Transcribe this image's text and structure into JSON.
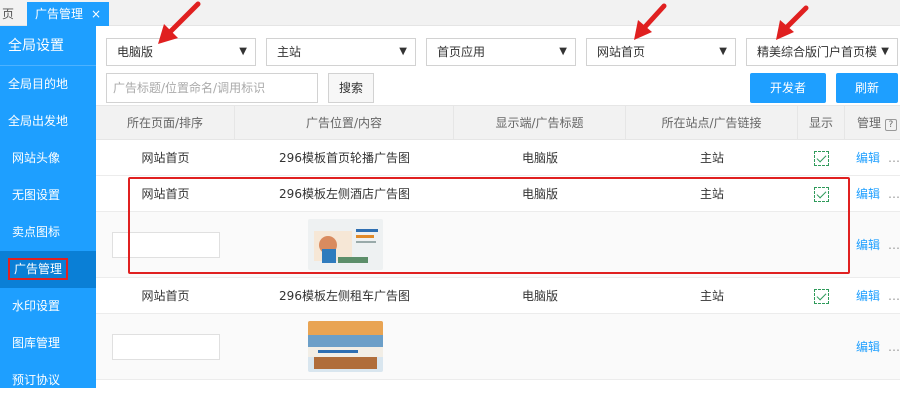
{
  "tabs": {
    "home_label": "页",
    "active_label": "广告管理",
    "close_glyph": "×"
  },
  "sidebar": {
    "title": "全局设置",
    "items": [
      {
        "label": "全局目的地"
      },
      {
        "label": "全局出发地"
      },
      {
        "label": "网站头像"
      },
      {
        "label": "无图设置"
      },
      {
        "label": "卖点图标"
      },
      {
        "label": "广告管理"
      },
      {
        "label": "水印设置"
      },
      {
        "label": "图库管理"
      },
      {
        "label": "预订协议"
      }
    ]
  },
  "filters": {
    "device": "电脑版",
    "site": "主站",
    "app": "首页应用",
    "page": "网站首页",
    "template": "精美综合版门户首页模"
  },
  "search": {
    "placeholder": "广告标题/位置命名/调用标识",
    "search_label": "搜索",
    "developer_label": "开发者",
    "refresh_label": "刷新"
  },
  "table": {
    "headers": [
      "所在页面/排序",
      "广告位置/内容",
      "显示端/广告标题",
      "所在站点/广告链接",
      "显示",
      "管理"
    ],
    "rows": [
      {
        "page": "网站首页",
        "position": "296模板首页轮播广告图",
        "device": "电脑版",
        "site": "主站",
        "edit": "编辑",
        "more": "…"
      },
      {
        "page": "网站首页",
        "position": "296模板左侧酒店广告图",
        "device": "电脑版",
        "site": "主站",
        "edit": "编辑",
        "more": "…"
      },
      {
        "edit": "编辑",
        "more": "…"
      },
      {
        "page": "网站首页",
        "position": "296模板左侧租车广告图",
        "device": "电脑版",
        "site": "主站",
        "edit": "编辑",
        "more": "…"
      },
      {
        "edit": "编辑",
        "more": "…"
      }
    ],
    "thumb_text": "酒店度假广告图"
  },
  "colors": {
    "primary": "#1e9fff",
    "annotation_red": "#e02020",
    "check_green": "#2e9a5a"
  }
}
